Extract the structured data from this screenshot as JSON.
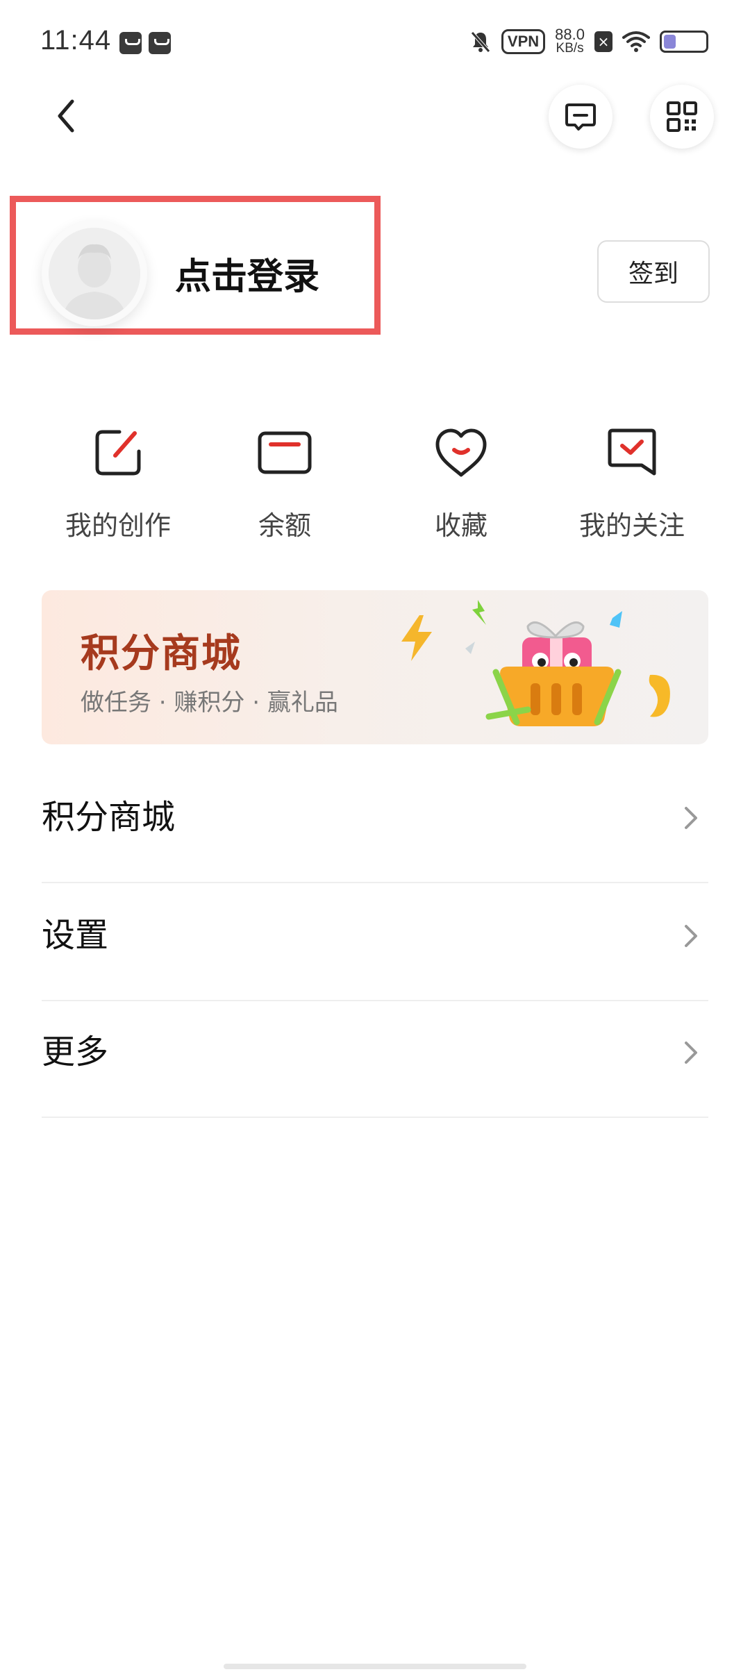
{
  "status_bar": {
    "time": "11:44",
    "vpn": "VPN",
    "net_speed_value": "88.0",
    "net_speed_unit": "KB/s",
    "battery_level": 0.3,
    "icons": [
      "notification-app-icon",
      "message-app-icon",
      "mute-icon",
      "vpn-icon",
      "sim-off-icon",
      "wifi-icon",
      "battery-icon"
    ]
  },
  "header": {
    "back_icon": "chevron-left-icon",
    "message_icon": "message-icon",
    "qr_icon": "qr-code-icon"
  },
  "profile": {
    "login_label": "点击登录",
    "checkin_label": "签到"
  },
  "quick_actions": [
    {
      "label": "我的创作",
      "icon": "edit-icon"
    },
    {
      "label": "余额",
      "icon": "wallet-icon"
    },
    {
      "label": "收藏",
      "icon": "heart-icon"
    },
    {
      "label": "我的关注",
      "icon": "follow-icon"
    }
  ],
  "banner": {
    "title": "积分商城",
    "subtitle": "做任务 · 赚积分 · 赢礼品"
  },
  "menu": [
    {
      "label": "积分商城"
    },
    {
      "label": "设置"
    },
    {
      "label": "更多"
    }
  ],
  "colors": {
    "accent_red": "#e0312b",
    "banner_title": "#a63a1e",
    "highlight_border": "#ec5a5a"
  }
}
